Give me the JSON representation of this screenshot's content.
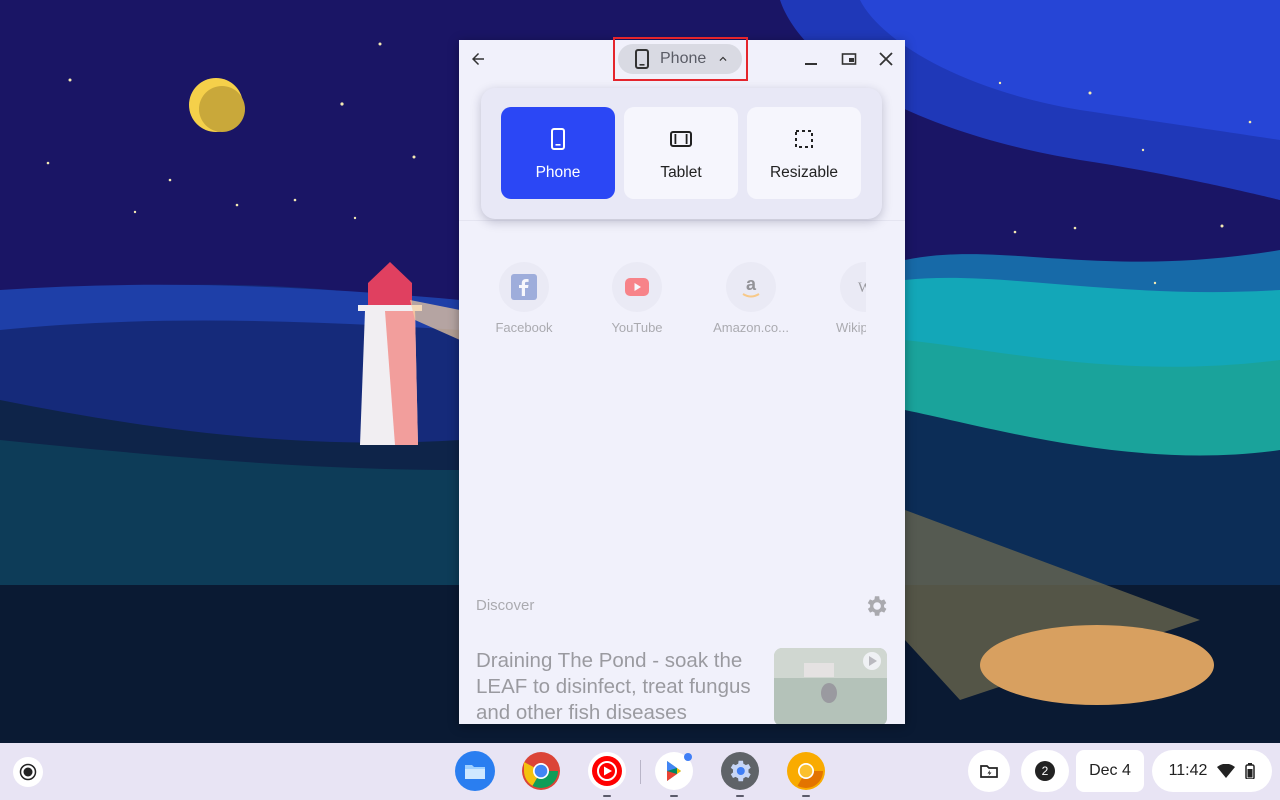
{
  "window": {
    "size_mode_label": "Phone"
  },
  "size_menu": {
    "options": [
      {
        "label": "Phone",
        "selected": true
      },
      {
        "label": "Tablet",
        "selected": false
      },
      {
        "label": "Resizable",
        "selected": false
      }
    ]
  },
  "shortcuts": [
    {
      "label": "Facebook",
      "icon": "facebook-icon"
    },
    {
      "label": "YouTube",
      "icon": "youtube-icon"
    },
    {
      "label": "Amazon.co...",
      "icon": "amazon-icon"
    },
    {
      "label": "Wikip",
      "icon": "wikipedia-icon"
    }
  ],
  "discover": {
    "label": "Discover",
    "article_title": "Draining The Pond - soak the LEAF to disinfect, treat fungus and other fish diseases"
  },
  "shelf": {
    "apps": [
      "files-icon",
      "chrome-icon",
      "youtube-music-icon",
      "play-store-icon",
      "settings-icon",
      "chrome-canary-icon"
    ],
    "notification_count": "2",
    "date": "Dec 4",
    "time": "11:42"
  },
  "colors": {
    "accent": "#2b47f5",
    "highlight": "#e5252c"
  }
}
